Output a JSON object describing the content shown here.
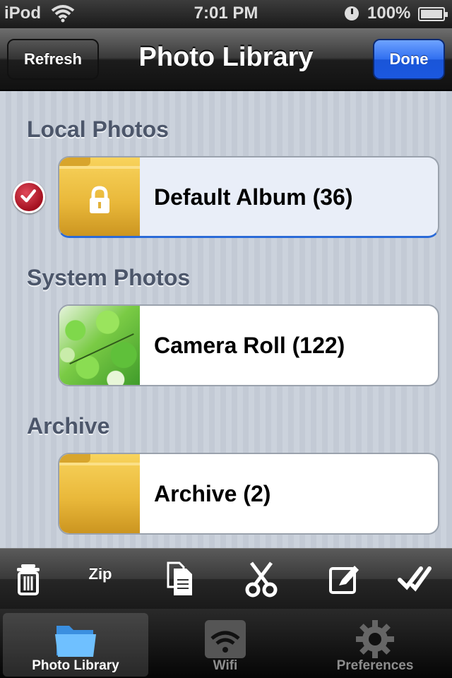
{
  "status_bar": {
    "carrier": "iPod",
    "time": "7:01 PM",
    "battery": "100%"
  },
  "nav": {
    "title": "Photo Library",
    "left_button": "Refresh",
    "right_button": "Done"
  },
  "sections": [
    {
      "header": "Local Photos",
      "item": {
        "label": "Default Album (36)",
        "icon": "locked-folder-icon",
        "selected": true
      }
    },
    {
      "header": "System Photos",
      "item": {
        "label": "Camera Roll (122)",
        "icon": "photo-thumbnail"
      }
    },
    {
      "header": "Archive",
      "item": {
        "label": "Archive (2)",
        "icon": "folder-icon"
      }
    }
  ],
  "toolbar": {
    "items": [
      {
        "icon": "trash-icon"
      },
      {
        "label": "Zip"
      },
      {
        "icon": "copy-icon"
      },
      {
        "icon": "scissors-icon"
      },
      {
        "icon": "edit-icon"
      },
      {
        "icon": "double-check-icon"
      }
    ]
  },
  "tabs": [
    {
      "label": "Photo Library",
      "icon": "folder-icon",
      "active": true
    },
    {
      "label": "Wifi",
      "icon": "wifi-icon"
    },
    {
      "label": "Preferences",
      "icon": "gear-icon"
    }
  ],
  "colors": {
    "done_button": "#2f6ef0",
    "section_header": "#4c566a",
    "selection_badge": "#b01525"
  }
}
